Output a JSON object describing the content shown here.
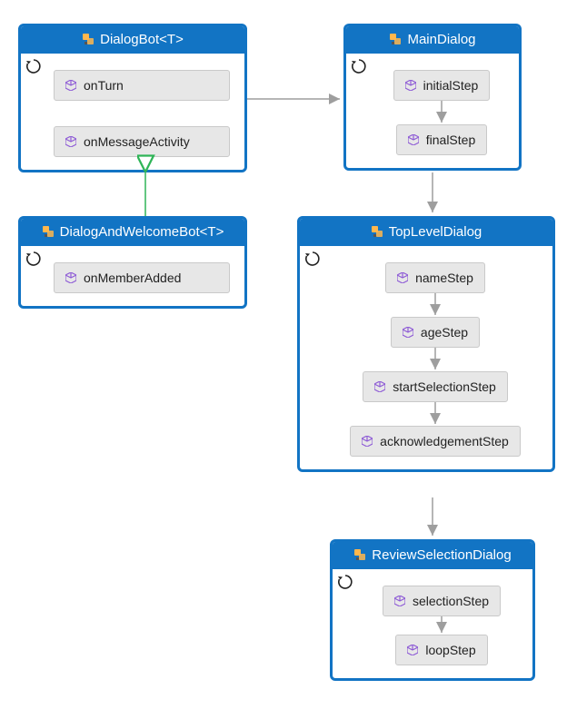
{
  "boxes": {
    "dialogBot": {
      "title": "DialogBot<T>",
      "steps": [
        "onTurn",
        "onMessageActivity"
      ]
    },
    "dialogAndWelcomeBot": {
      "title": "DialogAndWelcomeBot<T>",
      "steps": [
        "onMemberAdded"
      ]
    },
    "mainDialog": {
      "title": "MainDialog",
      "steps": [
        "initialStep",
        "finalStep"
      ]
    },
    "topLevelDialog": {
      "title": "TopLevelDialog",
      "steps": [
        "nameStep",
        "ageStep",
        "startSelectionStep",
        "acknowledgementStep"
      ]
    },
    "reviewSelectionDialog": {
      "title": "ReviewSelectionDialog",
      "steps": [
        "selectionStep",
        "loopStep"
      ]
    }
  }
}
